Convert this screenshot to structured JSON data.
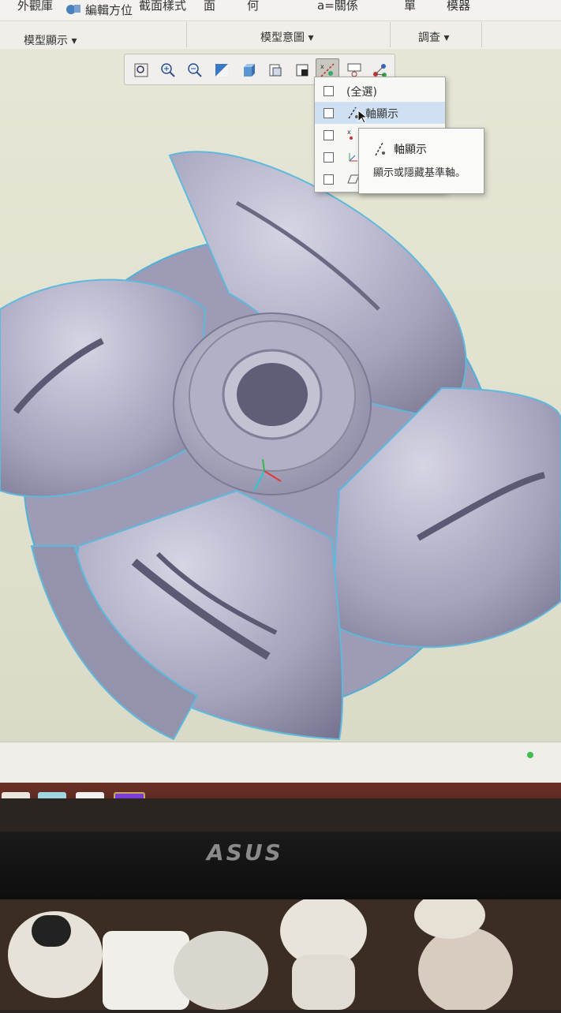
{
  "ribbon": {
    "row1": [
      "外觀庫",
      "編輯方位",
      "截面樣式",
      "面",
      "何",
      "a=關係",
      "單",
      "模器"
    ],
    "groups": [
      "模型顯示 ▾",
      "模型意圖 ▾",
      "調查 ▾"
    ]
  },
  "view_toolbar": {
    "buttons": [
      "zoom-fit-icon",
      "zoom-in-icon",
      "zoom-out-icon",
      "repaint-icon",
      "display-style-icon",
      "saved-views-icon",
      "view-manager-icon",
      "datum-display-icon",
      "annotation-display-icon",
      "spin-center-icon"
    ]
  },
  "datum_menu": {
    "items": [
      {
        "label": "(全選)",
        "checked": false
      },
      {
        "label": "軸顯示",
        "checked": false,
        "highlighted": true
      },
      {
        "label": "",
        "checked": false
      },
      {
        "label": "",
        "checked": false
      },
      {
        "label": "",
        "checked": false
      }
    ]
  },
  "tooltip": {
    "title": "軸顯示",
    "description": "顯示或隱藏基準軸。"
  },
  "hardware": {
    "monitor_brand": "ASUS"
  },
  "colors": {
    "ribbon": "#f3f2ee",
    "viewport": "#e2e3d0",
    "model": "#a8a6bf",
    "taskbar": "#5a2820",
    "highlight": "#cfe0f2"
  }
}
